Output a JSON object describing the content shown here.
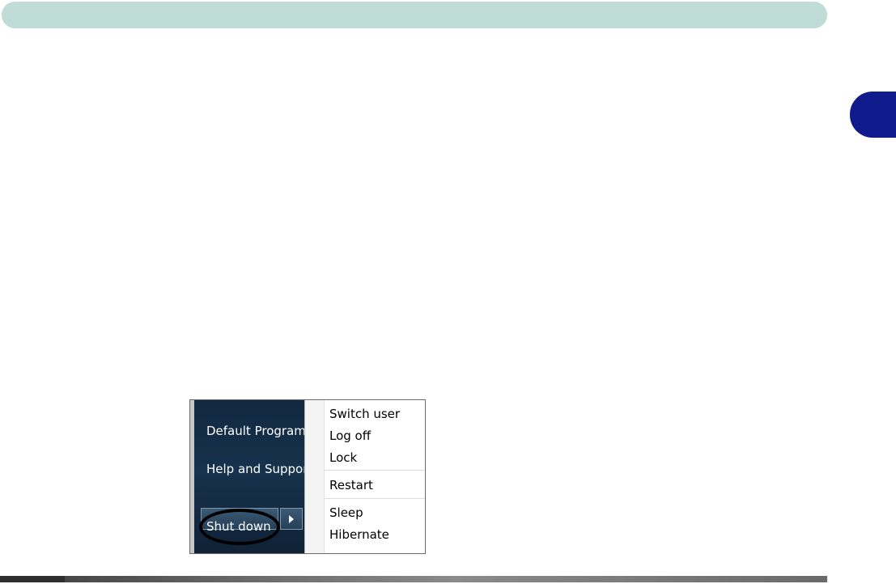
{
  "start_menu": {
    "items": [
      {
        "label": "Default Program"
      },
      {
        "label": "Help and Suppor"
      }
    ],
    "shutdown_label": "Shut down"
  },
  "power_menu": {
    "items": [
      {
        "label": "Switch user"
      },
      {
        "label": "Log off"
      },
      {
        "label": "Lock"
      },
      {
        "label": "Restart"
      },
      {
        "label": "Sleep"
      },
      {
        "label": "Hibernate"
      }
    ]
  },
  "colors": {
    "header_bar": "#bfdcd6",
    "chapter_tab": "#0f1a8c",
    "start_menu_bg": "#17324d",
    "highlight_circle": "#000000"
  }
}
